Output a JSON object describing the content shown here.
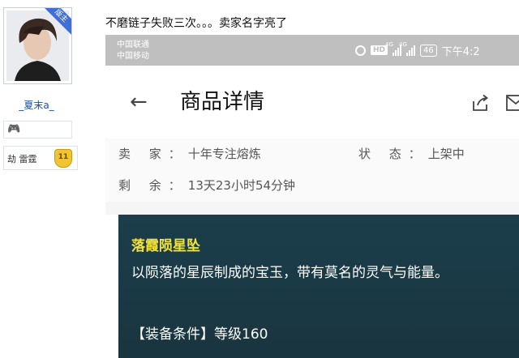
{
  "sidebar": {
    "ribbon": "版主",
    "username": "_夏末a_",
    "title": "劫 雷霆",
    "level_badge": "11"
  },
  "post": {
    "text": "不磨链子失败三次。。。卖家名字亮了"
  },
  "phone": {
    "status": {
      "carrier1": "中国联通",
      "carrier2": "中国移动",
      "net1": "4G",
      "net2": "4G",
      "battery": "46",
      "time": "下午4:2"
    },
    "header": {
      "title": "商品详情"
    },
    "info": {
      "seller_label": "卖 家：",
      "seller": "十年专注熔炼",
      "status_label": "状 态：",
      "status": "上架中",
      "remain_label": "剩 余：",
      "remain": "13天23小时54分钟"
    },
    "item": {
      "name": "落霞陨星坠",
      "description": "以陨落的星辰制成的宝玉，带有莫名的灵气与能量。",
      "requirement": "【装备条件】等级160"
    }
  }
}
